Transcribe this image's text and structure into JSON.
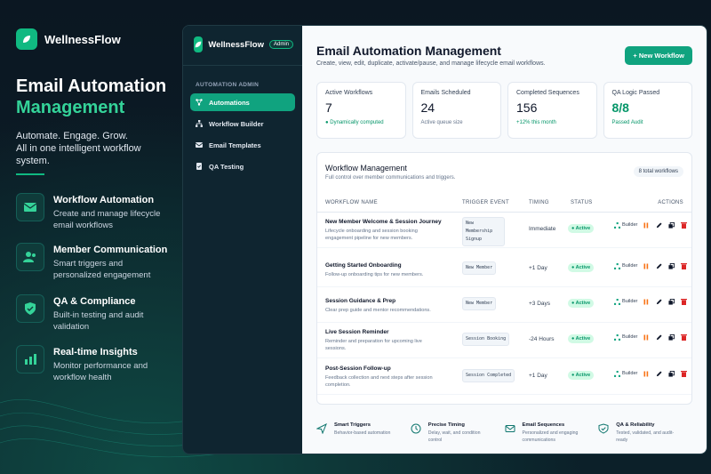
{
  "marketing": {
    "brand": "WellnessFlow",
    "hero_line1": "Email Automation",
    "hero_line2": "Management",
    "tagline_1": "Automate. Engage. Grow.",
    "tagline_2": "All in one intelligent workflow system.",
    "features": [
      {
        "title": "Workflow Automation",
        "desc": "Create and manage lifecycle email workflows",
        "icon": "mail-icon"
      },
      {
        "title": "Member Communication",
        "desc": "Smart triggers and personalized engagement",
        "icon": "users-icon"
      },
      {
        "title": "QA & Compliance",
        "desc": "Built-in testing and audit validation",
        "icon": "shield-check-icon"
      },
      {
        "title": "Real-time Insights",
        "desc": "Monitor performance and workflow health",
        "icon": "bar-chart-icon"
      }
    ]
  },
  "sidebar": {
    "brand": "WellnessFlow",
    "badge": "Admin",
    "section": "AUTOMATION ADMIN",
    "items": [
      {
        "label": "Automations",
        "icon": "automations-icon",
        "active": true
      },
      {
        "label": "Workflow Builder",
        "icon": "workflow-builder-icon"
      },
      {
        "label": "Email Templates",
        "icon": "email-templates-icon"
      },
      {
        "label": "QA Testing",
        "icon": "qa-testing-icon"
      }
    ]
  },
  "header": {
    "title": "Email Automation Management",
    "subtitle": "Create, view, edit, duplicate, activate/pause, and manage lifecycle email workflows.",
    "new_button": "+ New Workflow"
  },
  "stats": [
    {
      "label": "Active Workflows",
      "value": "7",
      "note": "● Dynamically computed"
    },
    {
      "label": "Emails Scheduled",
      "value": "24",
      "note": "Active queue size"
    },
    {
      "label": "Completed Sequences",
      "value": "156",
      "note": "+12% this month"
    },
    {
      "label": "QA Logic Passed",
      "value": "8/8",
      "note": "Passed Audit"
    }
  ],
  "table": {
    "title": "Workflow Management",
    "subtitle": "Full control over member communications and triggers.",
    "count": "8 total workflows",
    "columns": [
      "WORKFLOW NAME",
      "TRIGGER EVENT",
      "TIMING",
      "STATUS",
      "ACTIONS"
    ],
    "builder_label": "Builder",
    "rows": [
      {
        "name": "New Member Welcome & Session Journey",
        "desc": "Lifecycle onboarding and session booking engagement pipeline for new members.",
        "trigger": "New Membership Signup",
        "timing": "Immediate",
        "status": "Active"
      },
      {
        "name": "Getting Started Onboarding",
        "desc": "Follow-up onboarding tips for new members.",
        "trigger": "New Member",
        "timing": "+1 Day",
        "status": "Active"
      },
      {
        "name": "Session Guidance & Prep",
        "desc": "Clear prep guide and mentor recommendations.",
        "trigger": "New Member",
        "timing": "+3 Days",
        "status": "Active"
      },
      {
        "name": "Live Session Reminder",
        "desc": "Reminder and preparation for upcoming live sessions.",
        "trigger": "Session Booking",
        "timing": "-24 Hours",
        "status": "Active"
      },
      {
        "name": "Post-Session Follow-up",
        "desc": "Feedback collection and next steps after session completion.",
        "trigger": "Session Completed",
        "timing": "+1 Day",
        "status": "Active"
      }
    ]
  },
  "footer_features": [
    {
      "title": "Smart Triggers",
      "desc": "Behavior-based automation",
      "icon": "send-icon"
    },
    {
      "title": "Precise Timing",
      "desc": "Delay, wait, and condition control",
      "icon": "clock-icon"
    },
    {
      "title": "Email Sequences",
      "desc": "Personalized and engaging communications",
      "icon": "envelope-icon"
    },
    {
      "title": "QA & Reliability",
      "desc": "Tested, validated, and audit-ready",
      "icon": "shield-icon"
    }
  ],
  "colors": {
    "accent": "#10a37f",
    "accent_light": "#34d399",
    "bg_dark": "#0b1a24",
    "sidebar": "#0f2530"
  }
}
